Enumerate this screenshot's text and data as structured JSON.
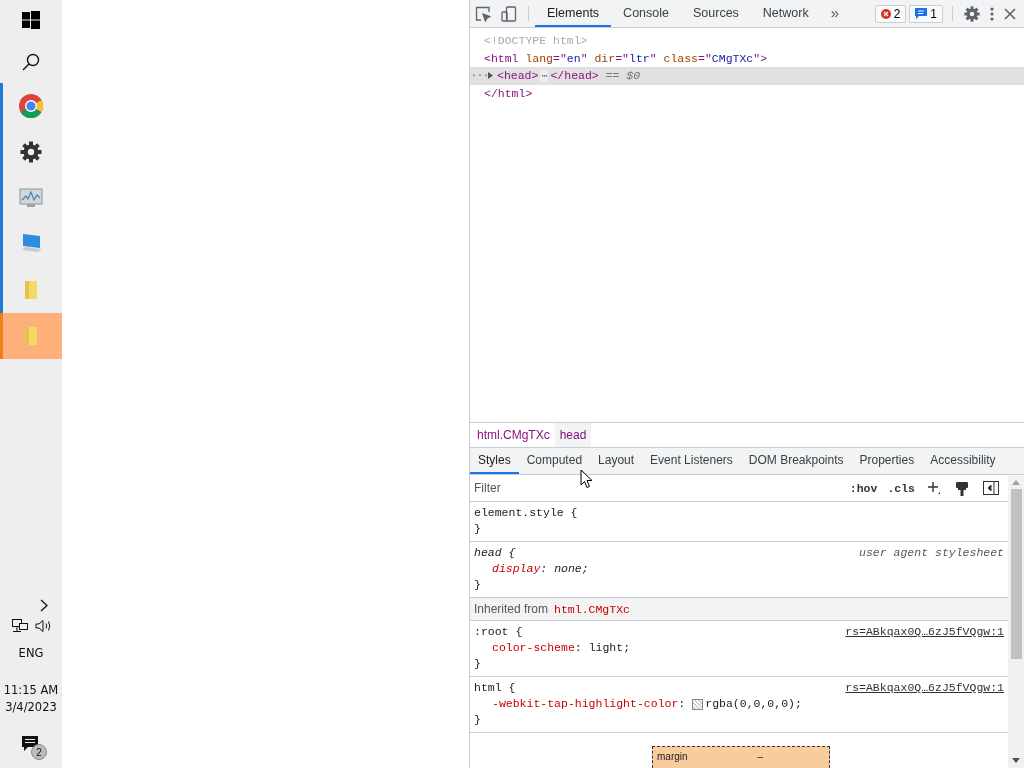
{
  "taskbar": {
    "apps": [
      {
        "kind": "chrome",
        "running": true,
        "selected": false
      },
      {
        "kind": "settings",
        "running": true,
        "selected": false
      },
      {
        "kind": "monitor",
        "running": true,
        "selected": false
      },
      {
        "kind": "computer",
        "running": true,
        "selected": false
      },
      {
        "kind": "folder",
        "running": true,
        "selected": false
      },
      {
        "kind": "folder",
        "running": true,
        "selected": true
      }
    ],
    "language": "ENG",
    "time": "11:15 AM",
    "date": "3/4/2023",
    "notifications": "2"
  },
  "devtools": {
    "tabs": [
      {
        "label": "Elements",
        "selected": true
      },
      {
        "label": "Console",
        "selected": false
      },
      {
        "label": "Sources",
        "selected": false
      },
      {
        "label": "Network",
        "selected": false
      }
    ],
    "overflow": "»",
    "errors": "2",
    "messages": "1",
    "dom_lines": [
      {
        "selected": false,
        "segments": [
          {
            "text": "<!DOCTYPE html>",
            "kind": "muted"
          }
        ]
      },
      {
        "selected": false,
        "segments": [
          {
            "text": "<html",
            "kind": "tag"
          },
          {
            "text": " lang",
            "kind": "attr"
          },
          {
            "text": "=\"",
            "kind": "tag"
          },
          {
            "text": "en",
            "kind": "value"
          },
          {
            "text": "\"",
            "kind": "tag"
          },
          {
            "text": " dir",
            "kind": "attr"
          },
          {
            "text": "=\"",
            "kind": "tag"
          },
          {
            "text": "ltr",
            "kind": "value"
          },
          {
            "text": "\"",
            "kind": "tag"
          },
          {
            "text": " class",
            "kind": "attr"
          },
          {
            "text": "=\"",
            "kind": "tag"
          },
          {
            "text": "CMgTXc",
            "kind": "value"
          },
          {
            "text": "\">",
            "kind": "tag"
          }
        ]
      },
      {
        "selected": true,
        "gutter": "···",
        "expanded": false,
        "segments": [
          {
            "text": "<head>",
            "kind": "tag"
          },
          {
            "text": "⋯",
            "kind": "ellipsis"
          },
          {
            "text": "</head>",
            "kind": "tag"
          },
          {
            "text": " == $0",
            "kind": "ref"
          }
        ]
      },
      {
        "selected": false,
        "segments": [
          {
            "text": "</html>",
            "kind": "tag"
          }
        ]
      }
    ],
    "breadcrumbs": [
      {
        "label": "html.CMgTXc",
        "selected": false
      },
      {
        "label": "head",
        "selected": true
      }
    ],
    "panel_tabs": [
      {
        "label": "Styles",
        "selected": true
      },
      {
        "label": "Computed",
        "selected": false
      },
      {
        "label": "Layout",
        "selected": false
      },
      {
        "label": "Event Listeners",
        "selected": false
      },
      {
        "label": "DOM Breakpoints",
        "selected": false
      },
      {
        "label": "Properties",
        "selected": false
      },
      {
        "label": "Accessibility",
        "selected": false
      }
    ],
    "filter": {
      "placeholder": "Filter"
    },
    "hov": ":hov",
    "cls": ".cls",
    "rules": [
      {
        "kind": "rule",
        "selector": "element.style {",
        "readonly": false,
        "close": "}"
      },
      {
        "kind": "rule",
        "selector": "head {",
        "readonly": true,
        "source": "user agent stylesheet",
        "close": "}",
        "declarations": [
          {
            "property": "display",
            "colon": ":",
            "value": "none;",
            "swatch": false
          }
        ]
      },
      {
        "kind": "inherited",
        "label": "Inherited from",
        "selector": "html.CMgTXc"
      },
      {
        "kind": "rule",
        "selector": ":root {",
        "readonly": false,
        "source": "rs=ABkqax0Q…6zJ5fVQgw:1",
        "close": "}",
        "declarations": [
          {
            "property": "color-scheme",
            "colon": ":",
            "value": "light;",
            "swatch": false
          }
        ]
      },
      {
        "kind": "rule",
        "selector": "html {",
        "readonly": false,
        "source": "rs=ABkqax0Q…6zJ5fVQgw:1",
        "close": "}",
        "declarations": [
          {
            "property": "-webkit-tap-highlight-color",
            "colon": ":",
            "value": "rgba(0,0,0,0);",
            "swatch": true
          }
        ]
      }
    ],
    "box_model": {
      "label": "margin",
      "value": "–"
    }
  }
}
